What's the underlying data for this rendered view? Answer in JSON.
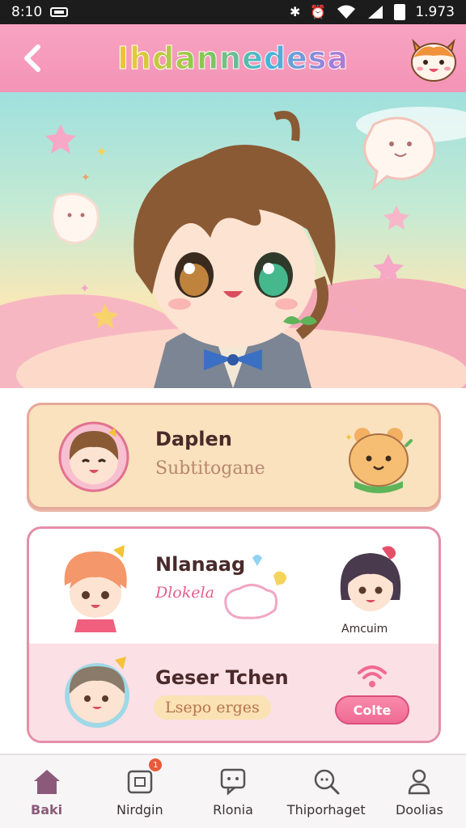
{
  "status_bar": {
    "time": "8:10",
    "battery_text": "1.97",
    "extra": "3"
  },
  "header": {
    "title": "Ihdannedesa",
    "back_icon": "back-arrow-icon",
    "avatar_icon": "cat-mascot-icon"
  },
  "cards": [
    {
      "name": "Daplen",
      "subtitle": "Subtitogane"
    },
    {
      "name": "Nlanaag",
      "subtitle": "Dlokela",
      "caption": "Amcuim"
    },
    {
      "name": "Geser Tchen",
      "tag": "Lsepo erges",
      "button_label": "Colte"
    }
  ],
  "bottom_nav": [
    {
      "label": "Baki",
      "icon": "home-icon",
      "active": true
    },
    {
      "label": "Nirdgin",
      "icon": "calendar-icon",
      "active": false,
      "badge": "1"
    },
    {
      "label": "Rlonia",
      "icon": "chat-icon",
      "active": false
    },
    {
      "label": "Thiporhaget",
      "icon": "search-icon",
      "active": false
    },
    {
      "label": "Doolias",
      "icon": "profile-icon",
      "active": false
    }
  ],
  "colors": {
    "header": "#f493b6",
    "card1_bg": "#f9e2bd",
    "card2_border": "#e48fa7",
    "accent_pink": "#f06b93",
    "nav_active": "#8b5a7a"
  }
}
